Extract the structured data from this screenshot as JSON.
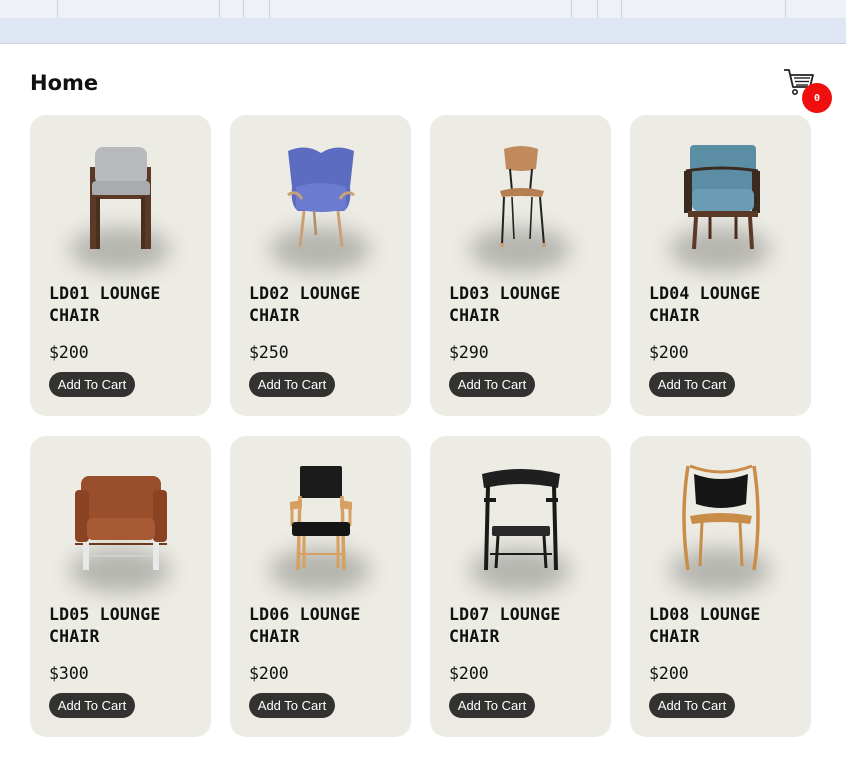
{
  "header": {
    "title": "Home"
  },
  "cart": {
    "count": "0",
    "badge_color": "#f00e0e"
  },
  "products": [
    {
      "name": "LD01 LOUNGE CHAIR",
      "price": "$200",
      "cta": "Add To Cart",
      "icon": "grey-armchair-icon"
    },
    {
      "name": "LD02 LOUNGE CHAIR",
      "price": "$250",
      "cta": "Add To Cart",
      "icon": "blue-wingback-chair-icon"
    },
    {
      "name": "LD03 LOUNGE CHAIR",
      "price": "$290",
      "cta": "Add To Cart",
      "icon": "wooden-side-chair-icon"
    },
    {
      "name": "LD04 LOUNGE CHAIR",
      "price": "$200",
      "cta": "Add To Cart",
      "icon": "teal-armchair-icon"
    },
    {
      "name": "LD05 LOUNGE CHAIR",
      "price": "$300",
      "cta": "Add To Cart",
      "icon": "leather-armchair-icon"
    },
    {
      "name": "LD06 LOUNGE CHAIR",
      "price": "$200",
      "cta": "Add To Cart",
      "icon": "black-oak-armchair-icon"
    },
    {
      "name": "LD07 LOUNGE CHAIR",
      "price": "$200",
      "cta": "Add To Cart",
      "icon": "black-lounge-chair-icon"
    },
    {
      "name": "LD08 LOUNGE CHAIR",
      "price": "$200",
      "cta": "Add To Cart",
      "icon": "shell-chair-icon"
    }
  ],
  "colors": {
    "card_bg": "#ecebe4",
    "button_bg": "#333230",
    "badge": "#f00e0e"
  }
}
